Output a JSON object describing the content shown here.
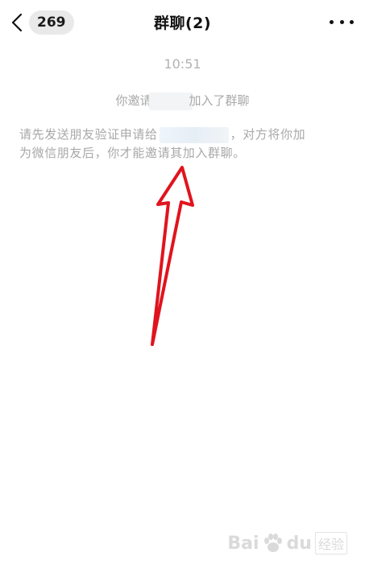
{
  "header": {
    "back_count": "269",
    "title": "群聊(2)"
  },
  "chat": {
    "time": "10:51",
    "notice1_before": "你邀请",
    "notice1_after": "加入了群聊",
    "notice2_line1_before": "请先发送朋友验证申请给",
    "notice2_line1_after": "，对方将你加",
    "notice2_line2": "为微信朋友后，你才能邀请其加入群聊。"
  },
  "watermark": {
    "latin": "Bai",
    "latin2": "du",
    "cn": "经验"
  },
  "colors": {
    "arrow": "#e0141e",
    "system_text": "#a8a8a8",
    "badge_bg": "#e9e9e9"
  },
  "icons": {
    "back": "chevron-left-icon",
    "more": "more-dots-icon",
    "annotation": "red-arrow-icon"
  }
}
